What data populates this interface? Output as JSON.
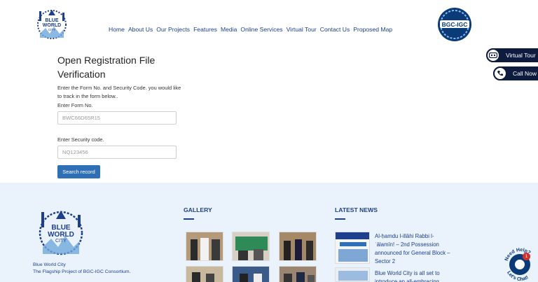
{
  "header": {
    "logo_text": [
      "BLUE",
      "WORLD",
      "CITY"
    ],
    "nav": [
      "Home",
      "About Us",
      "Our Projects",
      "Features",
      "Media",
      "Online Services",
      "Virtual Tour",
      "Contact Us",
      "Proposed Map"
    ],
    "partner_logo_text": "BGC-IGC"
  },
  "side_buttons": {
    "virtual_tour": "Virtual Tour",
    "call_now": "Call Now"
  },
  "form": {
    "title_line1": "Open Registration File",
    "title_line2": "Verification",
    "description": "Enter the Form No. and Security Code. you would like to track in the form below..",
    "form_no_label": "Enter Form No.",
    "form_no_placeholder": "BWC66D65R15",
    "security_label": "Enter Security code.",
    "security_placeholder": "NQ123456",
    "submit_label": "Search record"
  },
  "footer": {
    "logo_text": [
      "BLUE",
      "WORLD",
      "CITY"
    ],
    "tagline1": "Blue World City",
    "tagline2": "The Flagship Project of BGC-IGC Consortium.",
    "gallery_heading": "GALLERY",
    "news_heading": "LATEST NEWS",
    "news": [
      "Al-ḥamdu l-illāhi Rabbi l-ʿālamīn! – 2nd Possession announced for General Block – Sector 2",
      "Blue World City is all set to introduce an all-embracing"
    ]
  },
  "chat": {
    "label_top": "Need Help?",
    "label_bottom": "Let's Chat!",
    "badge_count": "1"
  },
  "colors": {
    "brand_navy": "#1d3f8c",
    "button_blue": "#2e6fb5",
    "footer_bg": "#eaf2fb",
    "side_button_bg": "#0d1b3e",
    "chat_badge": "#d0312d"
  }
}
